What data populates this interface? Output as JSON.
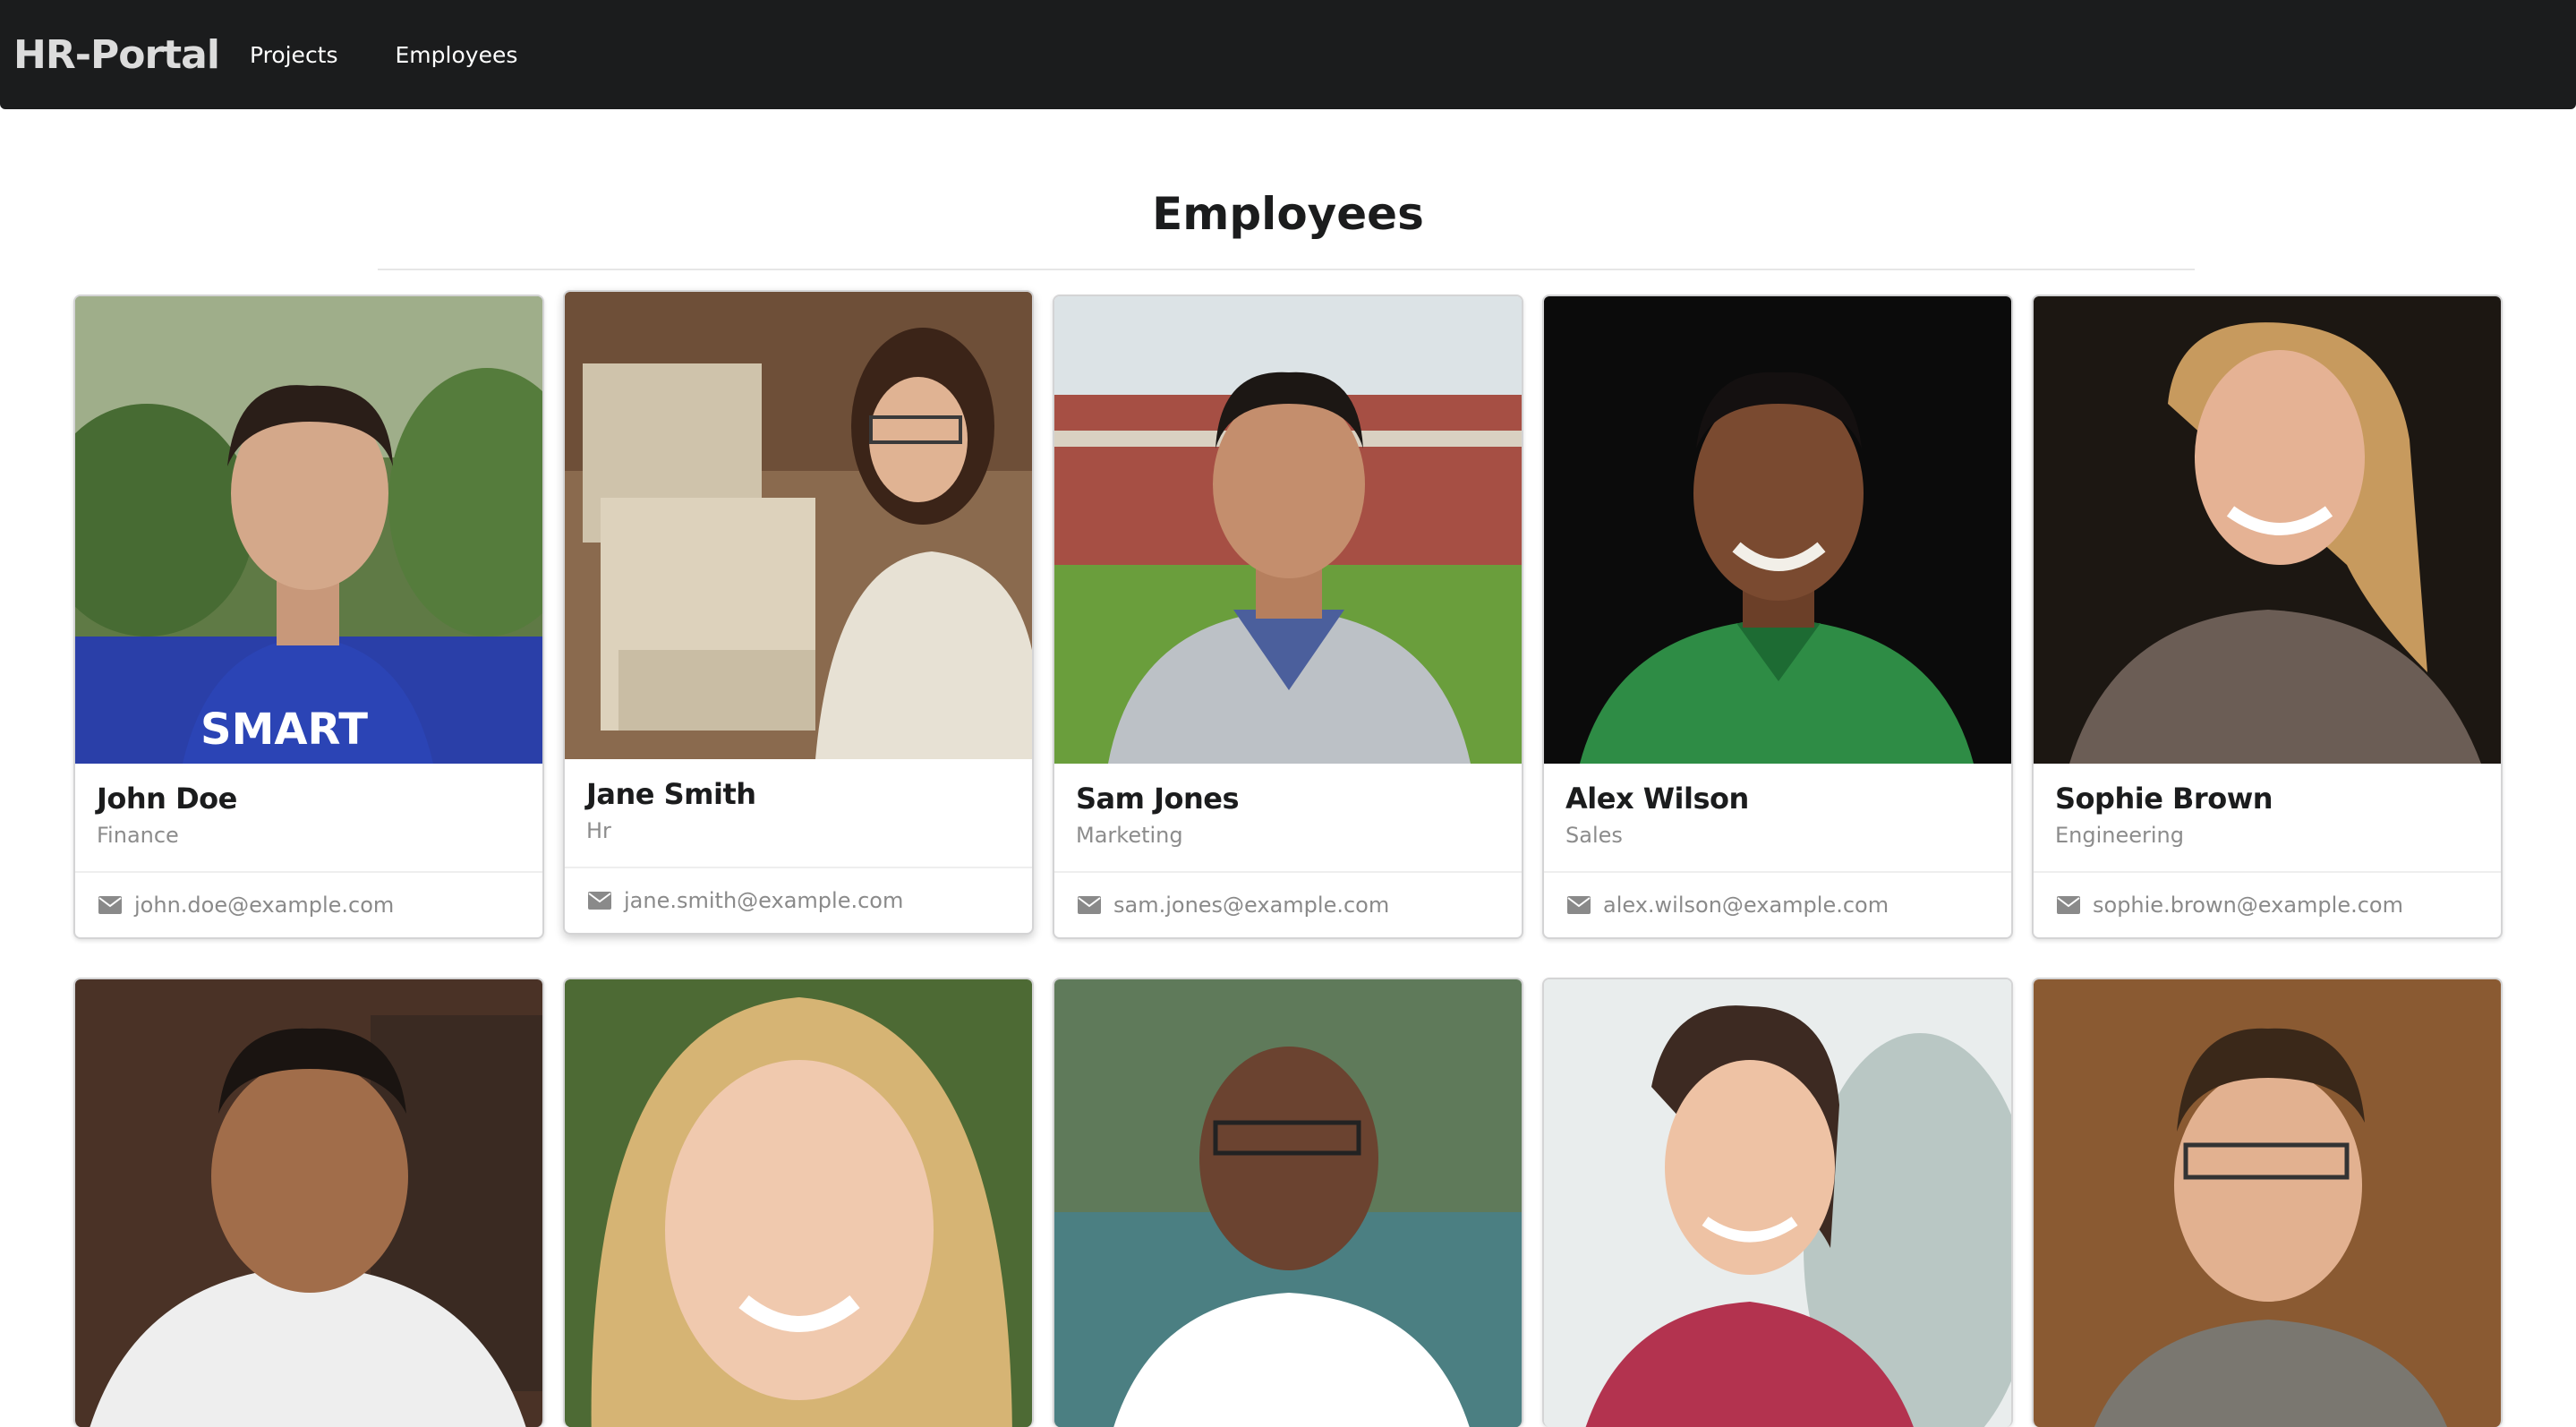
{
  "nav": {
    "brand": "HR-Portal",
    "items": [
      "Projects",
      "Employees"
    ]
  },
  "page": {
    "title": "Employees"
  },
  "employees": [
    {
      "name": "John Doe",
      "department": "Finance",
      "email": "john.doe@example.com"
    },
    {
      "name": "Jane Smith",
      "department": "Hr",
      "email": "jane.smith@example.com"
    },
    {
      "name": "Sam Jones",
      "department": "Marketing",
      "email": "sam.jones@example.com"
    },
    {
      "name": "Alex Wilson",
      "department": "Sales",
      "email": "alex.wilson@example.com"
    },
    {
      "name": "Sophie Brown",
      "department": "Engineering",
      "email": "sophie.brown@example.com"
    }
  ],
  "icons": {
    "email": "envelope-icon"
  },
  "colors": {
    "navbar": "#1b1c1d",
    "muted_text": "#8c8c8c",
    "card_border": "#d4d4d5"
  }
}
